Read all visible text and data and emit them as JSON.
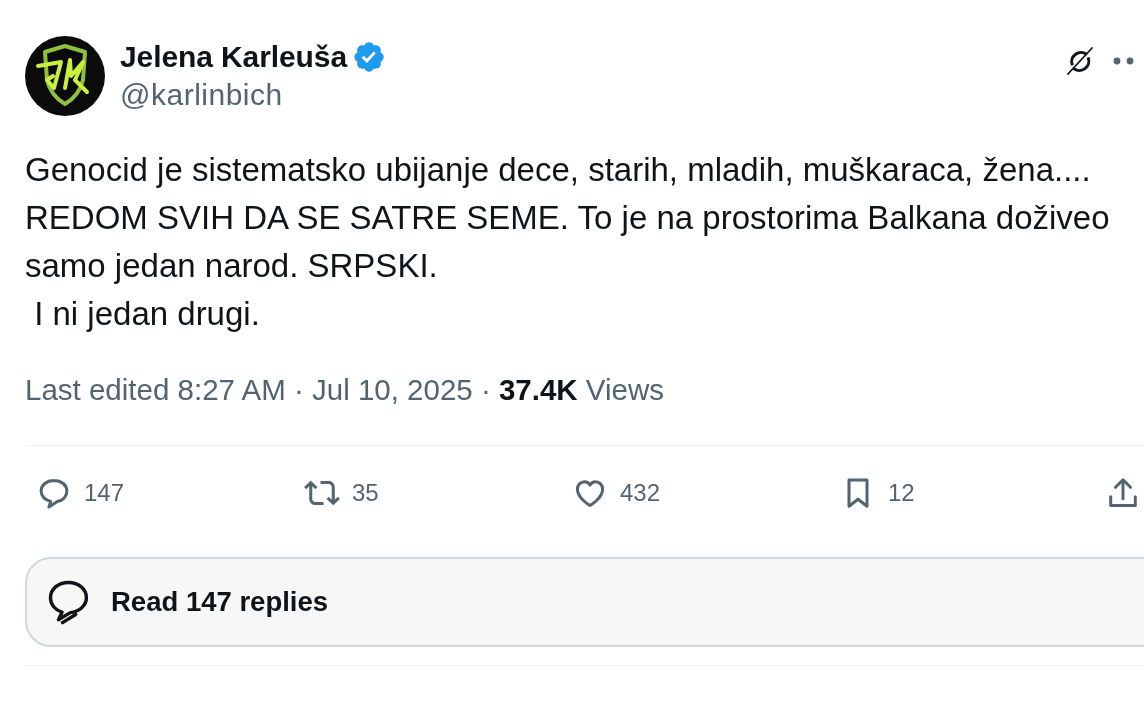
{
  "author": {
    "name": "Jelena Karleuša",
    "verified": true,
    "handle": "@karlinbich"
  },
  "post": {
    "text": "Genocid je sistematsko ubijanje dece, starih, mladih, muškaraca, žena....\nREDOM SVIH DA SE SATRE SEME. To je na prostorima Balkana doživeo\nsamo jedan narod. SRPSKI.\n I ni jedan drugi.",
    "meta": "Last edited 8:27 AM · Jul 10, 2025 · **37.4K** Views"
  },
  "actions": [
    {
      "kind": "reply",
      "count": "147"
    },
    {
      "kind": "repost",
      "count": "35"
    },
    {
      "kind": "like",
      "count": "432"
    },
    {
      "kind": "bookmark",
      "count": "12"
    },
    {
      "kind": "share"
    }
  ],
  "read_replies": {
    "label": "Read 147 replies"
  }
}
